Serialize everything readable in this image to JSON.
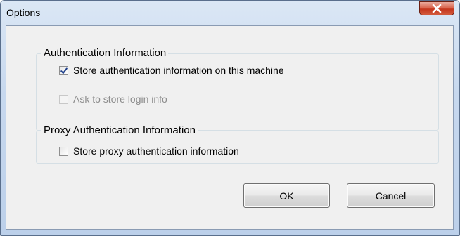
{
  "window": {
    "title": "Options"
  },
  "auth_group": {
    "legend": "Authentication Information",
    "store_auth": {
      "label": "Store authentication information on this machine",
      "checked": true
    },
    "ask_store": {
      "label": "Ask to store login info",
      "checked": false,
      "disabled": true
    }
  },
  "proxy_group": {
    "legend": "Proxy Authentication Information",
    "store_proxy": {
      "label": "Store proxy authentication information",
      "checked": false
    }
  },
  "buttons": {
    "ok_label": "OK",
    "cancel_label": "Cancel"
  },
  "colors": {
    "title_bar": "#c7d8ee",
    "close_button": "#c4361d",
    "client_bg": "#f0f0f0",
    "check_mark": "#1e3f8a",
    "disabled_text": "#8d8d8d"
  }
}
